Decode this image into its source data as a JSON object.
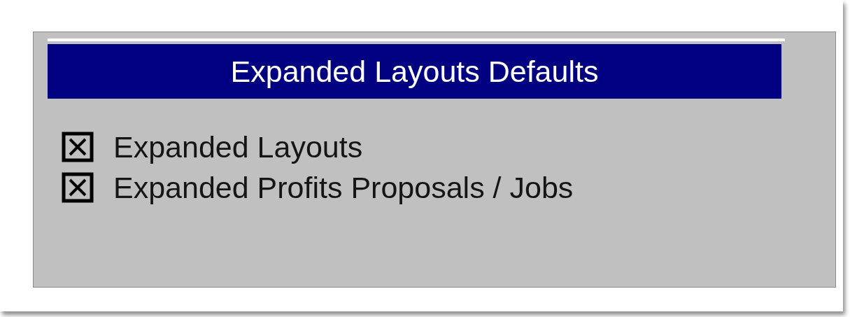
{
  "section": {
    "title": "Expanded Layouts Defaults"
  },
  "options": [
    {
      "label": "Expanded Layouts",
      "checked": true
    },
    {
      "label": "Expanded Profits Proposals / Jobs",
      "checked": true
    }
  ]
}
